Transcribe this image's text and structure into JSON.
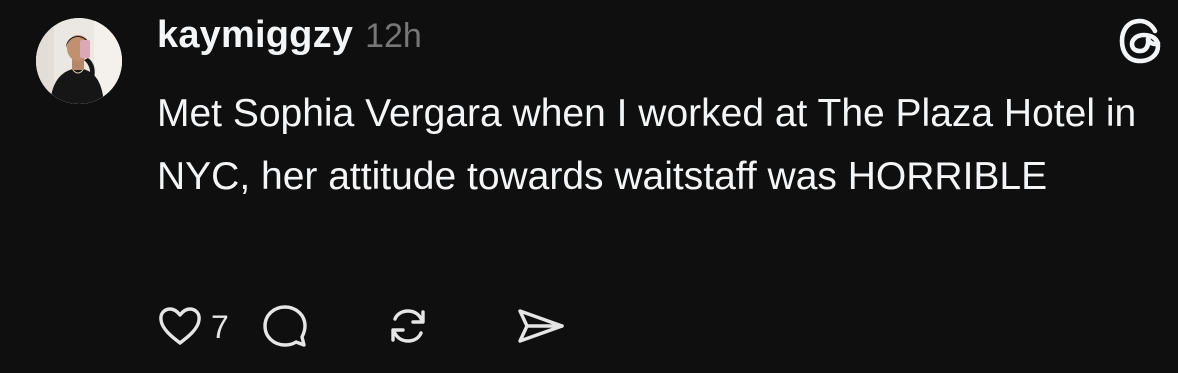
{
  "post": {
    "username": "kaymiggzy",
    "timestamp": "12h",
    "text": "Met Sophia Vergara when I worked at The Plaza Hotel in NYC, her attitude towards waitstaff was HORRIBLE",
    "like_count": "7"
  },
  "icons": {
    "logo": "threads-logo-icon",
    "like": "heart-icon",
    "reply": "speech-bubble-icon",
    "repost": "repost-arrows-icon",
    "share": "send-icon"
  },
  "colors": {
    "background": "#0f0f0f",
    "text": "#f3f5f7",
    "muted": "#777777"
  }
}
